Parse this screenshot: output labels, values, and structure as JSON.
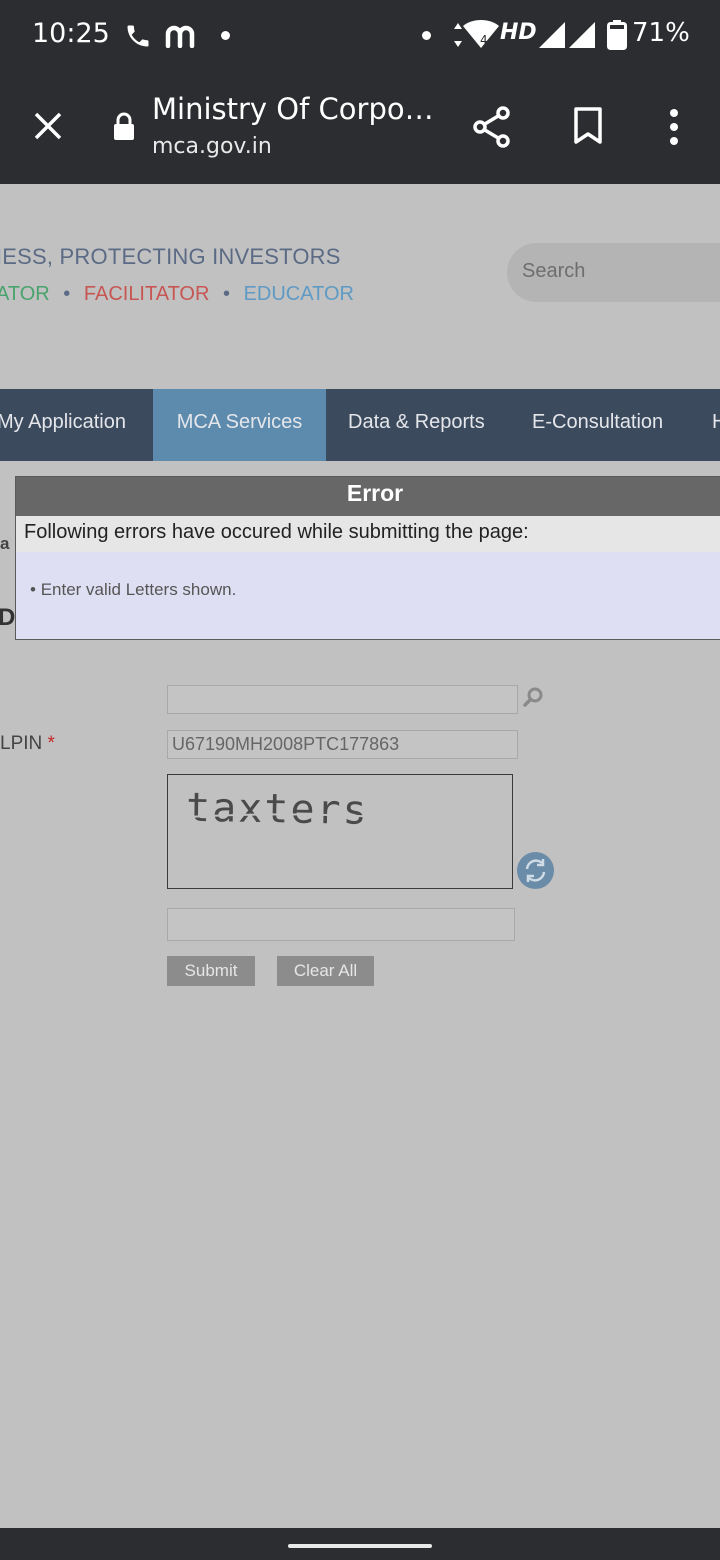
{
  "status_bar": {
    "time": "10:25",
    "network": "HD",
    "battery": "71%",
    "icons": [
      "phone-icon",
      "app-m-icon",
      "dot-icon",
      "wifi-icon",
      "signal-icon",
      "battery-icon"
    ]
  },
  "browser": {
    "page_title": "Ministry Of Corpo…",
    "url": "mca.gov.in",
    "icons": [
      "close-icon",
      "lock-icon",
      "share-icon",
      "bookmark-icon",
      "more-icon"
    ]
  },
  "header": {
    "tagline": "IESS, PROTECTING INVESTORS",
    "roles": [
      {
        "text": "ATOR",
        "color": "#4aa36d"
      },
      {
        "text": "FACILITATOR",
        "color": "#c75653"
      },
      {
        "text": "EDUCATOR",
        "color": "#5f9ac4"
      }
    ],
    "search_placeholder": "Search"
  },
  "nav": {
    "items": [
      "My Application",
      "MCA Services",
      "Data & Reports",
      "E-Consultation",
      "H"
    ],
    "active": "MCA Services"
  },
  "error_box": {
    "title": "Error",
    "message": "Following errors have occured while submitting the page:",
    "errors": [
      "Enter valid Letters shown."
    ]
  },
  "side_labels": {
    "a": "a",
    "da": "Da",
    "llpin": "LPIN",
    "required_mark": "*"
  },
  "form": {
    "search_value": "",
    "llpin_value": "U67190MH2008PTC177863",
    "captcha_text": "taxters",
    "captcha_input": "",
    "submit_label": "Submit",
    "clear_label": "Clear All"
  },
  "colors": {
    "nav_bg": "#3c4a5e",
    "nav_active": "#5d8bae",
    "error_header": "#676767",
    "error_body": "#dfdff3"
  }
}
